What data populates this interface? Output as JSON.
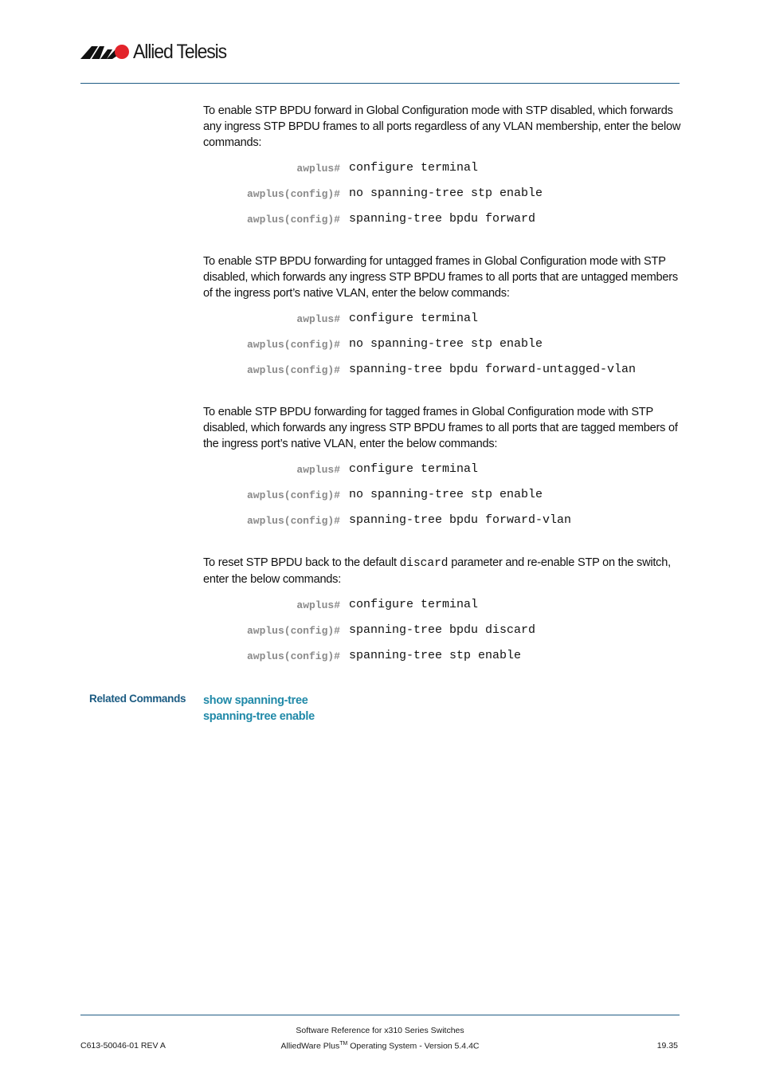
{
  "header": {
    "brand": "Allied Telesis",
    "logo_icon": "allied-telesis-logo-icon",
    "colors": {
      "rule": "#1f5c85",
      "logo_red": "#e3242b",
      "logo_black": "#111111"
    }
  },
  "sections": [
    {
      "paragraph": "To enable STP BPDU forward in Global Configuration mode with STP disabled, which forwards any ingress STP BPDU frames to all ports regardless of any VLAN membership, enter the below commands:",
      "commands": [
        {
          "prompt": "awplus#",
          "command": "configure terminal"
        },
        {
          "prompt": "awplus(config)#",
          "command": "no spanning-tree stp enable"
        },
        {
          "prompt": "awplus(config)#",
          "command": "spanning-tree bpdu forward"
        }
      ]
    },
    {
      "paragraph": "To enable STP BPDU forwarding for untagged frames in Global Configuration mode with STP disabled, which forwards any ingress STP BPDU frames to all ports that are untagged members of the ingress port’s native VLAN, enter the below commands:",
      "commands": [
        {
          "prompt": "awplus#",
          "command": "configure terminal"
        },
        {
          "prompt": "awplus(config)#",
          "command": "no spanning-tree stp enable"
        },
        {
          "prompt": "awplus(config)#",
          "command": "spanning-tree bpdu forward-untagged-vlan"
        }
      ]
    },
    {
      "paragraph": "To enable STP BPDU forwarding for tagged frames in Global Configuration mode with STP disabled, which forwards any ingress STP BPDU frames to all ports that are tagged members of the ingress port’s native VLAN, enter the below commands:",
      "commands": [
        {
          "prompt": "awplus#",
          "command": "configure terminal"
        },
        {
          "prompt": "awplus(config)#",
          "command": "no spanning-tree stp enable"
        },
        {
          "prompt": "awplus(config)#",
          "command": "spanning-tree bpdu forward-vlan"
        }
      ]
    },
    {
      "paragraph_before": "To reset STP BPDU back to the default ",
      "paragraph_code": "discard",
      "paragraph_after": " parameter and re-enable STP on the switch, enter the below commands:",
      "commands": [
        {
          "prompt": "awplus#",
          "command": "configure terminal"
        },
        {
          "prompt": "awplus(config)#",
          "command": "spanning-tree bpdu discard"
        },
        {
          "prompt": "awplus(config)#",
          "command": "spanning-tree stp enable"
        }
      ]
    }
  ],
  "related": {
    "label": "Related Commands",
    "links": [
      "show spanning-tree",
      "spanning-tree enable"
    ]
  },
  "footer": {
    "title": "Software Reference for x310 Series Switches",
    "os_prefix": "AlliedWare Plus",
    "os_sup": "TM",
    "os_suffix": " Operating System - Version 5.4.4C",
    "doc_id": "C613-50046-01 REV A",
    "page": "19.35"
  }
}
